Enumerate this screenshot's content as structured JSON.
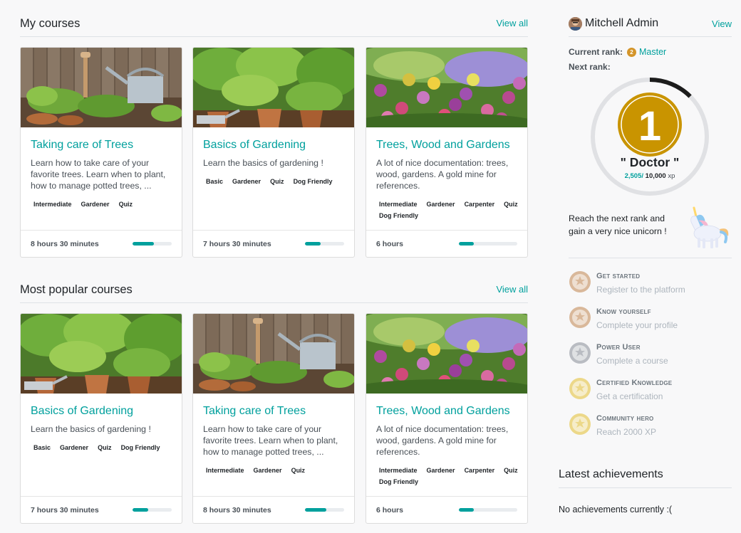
{
  "my_courses": {
    "title": "My courses",
    "view_all": "View all",
    "cards": [
      {
        "title": "Taking care of Trees",
        "desc": "Learn how to take care of your favorite trees. Learn when to plant, how to manage potted trees, ...",
        "tags": [
          "Intermediate",
          "Gardener",
          "Quiz"
        ],
        "duration": "8 hours 30 minutes",
        "progress": 0.55,
        "image": "tools-garden"
      },
      {
        "title": "Basics of Gardening",
        "desc": "Learn the basics of gardening !",
        "tags": [
          "Basic",
          "Gardener",
          "Quiz",
          "Dog Friendly"
        ],
        "duration": "7 hours 30 minutes",
        "progress": 0.4,
        "image": "pots-garden"
      },
      {
        "title": "Trees, Wood and Gardens",
        "desc": "A lot of nice documentation: trees, wood, gardens. A gold mine for references.",
        "tags": [
          "Intermediate",
          "Gardener",
          "Carpenter",
          "Quiz",
          "Dog Friendly"
        ],
        "duration": "6 hours",
        "progress": 0.25,
        "image": "flower-garden"
      }
    ]
  },
  "popular_courses": {
    "title": "Most popular courses",
    "view_all": "View all",
    "cards": [
      {
        "title": "Basics of Gardening",
        "desc": "Learn the basics of gardening !",
        "tags": [
          "Basic",
          "Gardener",
          "Quiz",
          "Dog Friendly"
        ],
        "duration": "7 hours 30 minutes",
        "progress": 0.4,
        "image": "pots-garden"
      },
      {
        "title": "Taking care of Trees",
        "desc": "Learn how to take care of your favorite trees. Learn when to plant, how to manage potted trees, ...",
        "tags": [
          "Intermediate",
          "Gardener",
          "Quiz"
        ],
        "duration": "8 hours 30 minutes",
        "progress": 0.55,
        "image": "tools-garden"
      },
      {
        "title": "Trees, Wood and Gardens",
        "desc": "A lot of nice documentation: trees, wood, gardens. A gold mine for references.",
        "tags": [
          "Intermediate",
          "Gardener",
          "Carpenter",
          "Quiz",
          "Dog Friendly"
        ],
        "duration": "6 hours",
        "progress": 0.25,
        "image": "flower-garden"
      }
    ]
  },
  "profile": {
    "name": "Mitchell Admin",
    "view": "View",
    "current_rank_label": "Current rank:",
    "current_rank_badge": "2",
    "current_rank": "Master",
    "next_rank_label": "Next rank:",
    "next_rank_number": "1",
    "next_rank_name": "\" Doctor \"",
    "xp_current": "2,505",
    "xp_sep": "/ ",
    "xp_total": "10,000",
    "xp_unit": "xp",
    "xp_progress": 0.25,
    "next_rank_text": "Reach the next rank and gain a very nice unicorn !",
    "badges": [
      {
        "title": "Get started",
        "desc": "Register to the platform",
        "color": "#d9b89a"
      },
      {
        "title": "Know yourself",
        "desc": "Complete your profile",
        "color": "#d9b89a"
      },
      {
        "title": "Power User",
        "desc": "Complete a course",
        "color": "#b9bcc2"
      },
      {
        "title": "Certified Knowledge",
        "desc": "Get a certification",
        "color": "#ecd889"
      },
      {
        "title": "Community hero",
        "desc": "Reach 2000 XP",
        "color": "#ecd889"
      }
    ]
  },
  "achievements": {
    "title": "Latest achievements",
    "empty": "No achievements currently :("
  },
  "colors": {
    "accent": "#00a09d",
    "rank_gold": "#c99400"
  }
}
